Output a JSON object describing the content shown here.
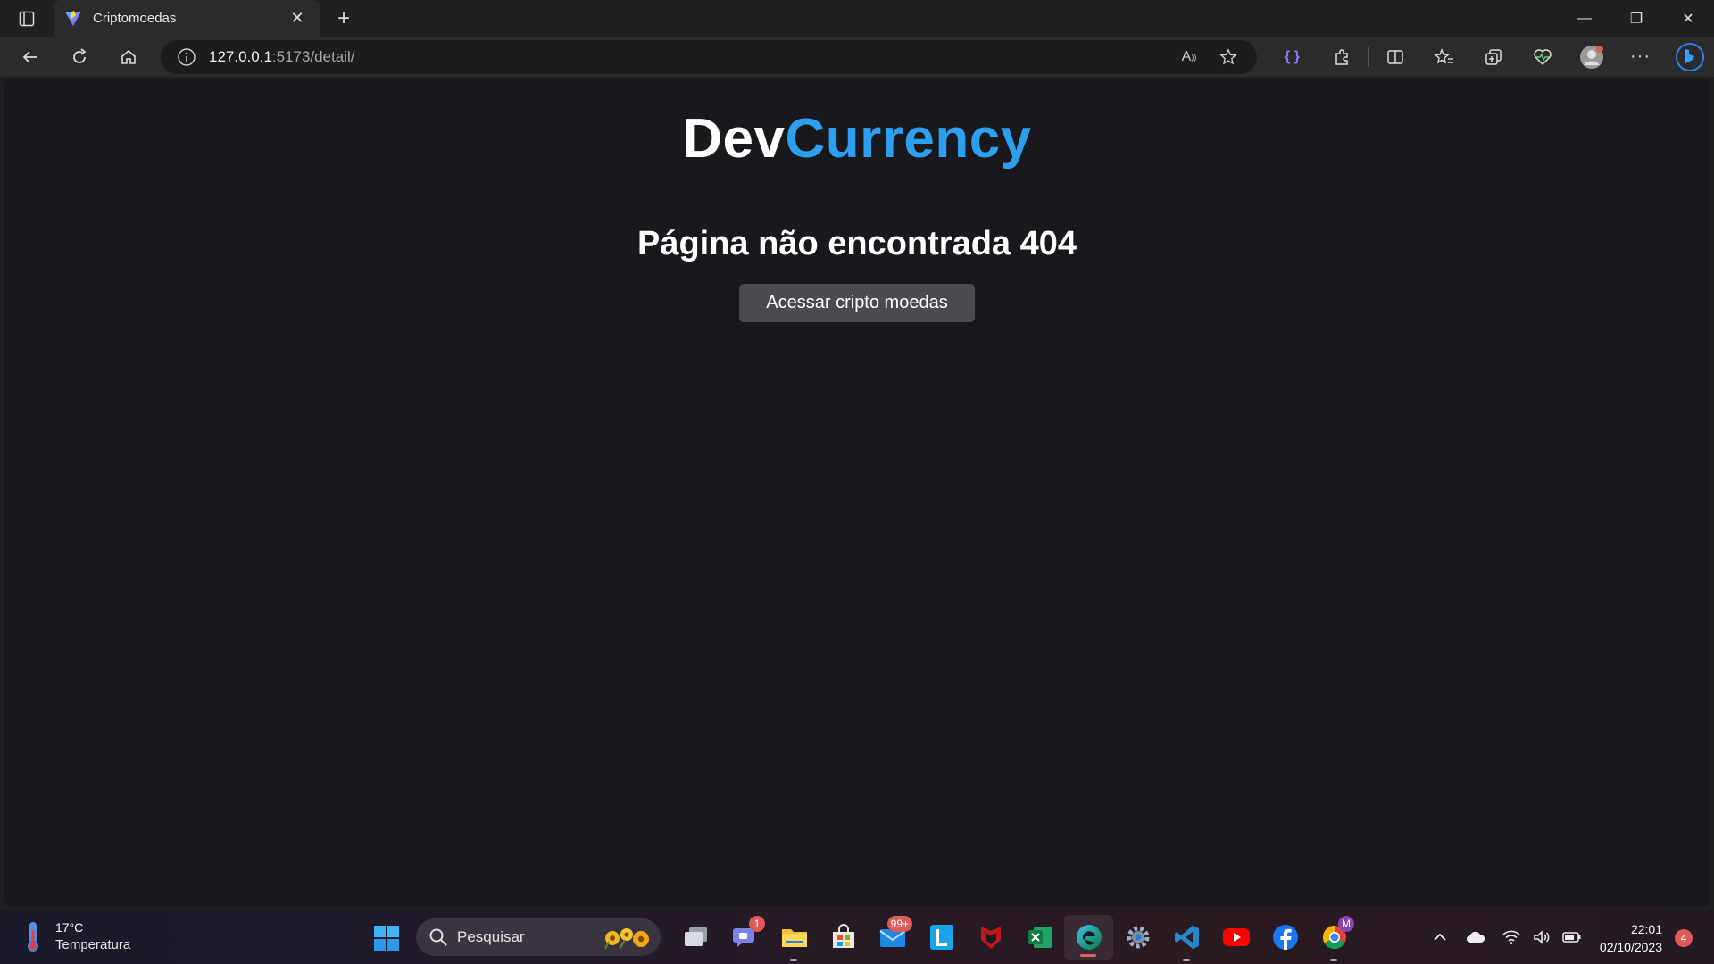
{
  "browser": {
    "tab_title": "Criptomoedas",
    "url_host": "127.0.0.1",
    "url_rest": ":5173/detail/"
  },
  "page": {
    "logo_part1": "Dev",
    "logo_part2": "Currency",
    "heading": "Página não encontrada 404",
    "button_label": "Acessar cripto moedas",
    "colors": {
      "background": "#18181d",
      "accent": "#2e9ff0",
      "button": "#4a4a4f"
    }
  },
  "taskbar": {
    "weather_temp": "17°C",
    "weather_label": "Temperatura",
    "search_placeholder": "Pesquisar",
    "teams_badge": "1",
    "mail_badge": "99+",
    "chrome_badge": "M",
    "time": "22:01",
    "date": "02/10/2023",
    "notification_count": "4"
  }
}
